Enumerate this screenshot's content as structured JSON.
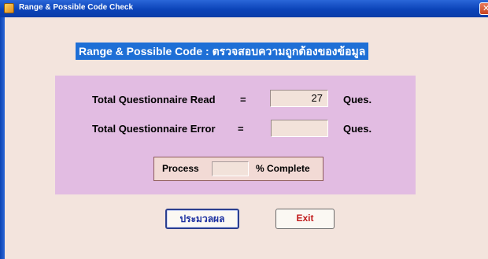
{
  "window": {
    "title": "Range & Possible Code Check"
  },
  "heading": "Range & Possible Code :  ตรวจสอบความถูกต้องของข้อมูล",
  "read": {
    "label": "Total  Questionnaire  Read",
    "eq": "=",
    "value": "27",
    "unit": "Ques."
  },
  "error": {
    "label": "Total  Questionnaire  Error",
    "eq": "=",
    "value": "",
    "unit": "Ques."
  },
  "process": {
    "label": "Process",
    "value": "",
    "suffix": "% Complete"
  },
  "buttons": {
    "process": "ประมวลผล",
    "exit": "Exit"
  },
  "colors": {
    "titlebar": "#0b43b8",
    "background": "#f3e4dd",
    "panel": "#e2bce2",
    "heading_bg": "#1e6fd6",
    "exit_text": "#c11a1a"
  }
}
